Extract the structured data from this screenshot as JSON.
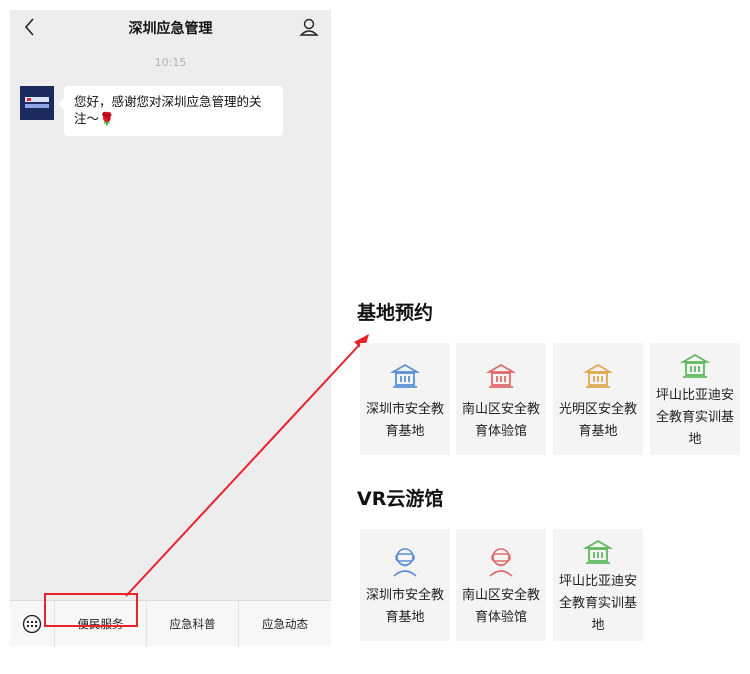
{
  "phone": {
    "nav_title": "深圳应急管理",
    "time": "10:15",
    "message": "您好，感谢您对深圳应急管理的关注～🌹",
    "menu": [
      {
        "label": "便民服务"
      },
      {
        "label": "应急科普"
      },
      {
        "label": "应急动态"
      }
    ]
  },
  "base_booking": {
    "title": "基地预约",
    "cards": [
      {
        "label": "深圳市安全教育基地",
        "color": "#5b8fd6"
      },
      {
        "label": "南山区安全教育体验馆",
        "color": "#e06a6a"
      },
      {
        "label": "光明区安全教育基地",
        "color": "#e0a84f"
      },
      {
        "label": "坪山比亚迪安全教育实训基地",
        "color": "#5fb85f"
      }
    ]
  },
  "vr": {
    "title": "VR云游馆",
    "cards": [
      {
        "label": "深圳市安全教育基地",
        "color": "#5b8fd6"
      },
      {
        "label": "南山区安全教育体验馆",
        "color": "#e06a6a"
      },
      {
        "label": "坪山比亚迪安全教育实训基地",
        "color": "#5fb85f"
      }
    ]
  },
  "colors": {
    "highlight": "#e8232a"
  }
}
